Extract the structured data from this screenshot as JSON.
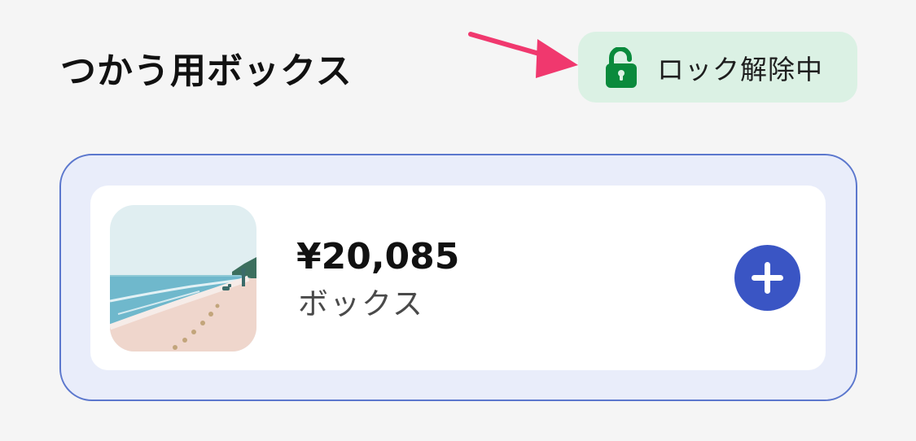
{
  "header": {
    "title": "つかう用ボックス"
  },
  "lock_status": {
    "label": "ロック解除中",
    "icon": "unlocked-padlock-icon",
    "background_color": "#dbf1e4",
    "icon_color": "#0a8a3c"
  },
  "annotation": {
    "icon": "pointer-arrow-icon",
    "color": "#f0386e"
  },
  "box": {
    "amount": "¥20,085",
    "name": "ボックス",
    "image": "beach-scene-image",
    "add_icon": "plus-icon",
    "accent_color": "#3a55c4",
    "frame_color": "#5b77cd"
  }
}
